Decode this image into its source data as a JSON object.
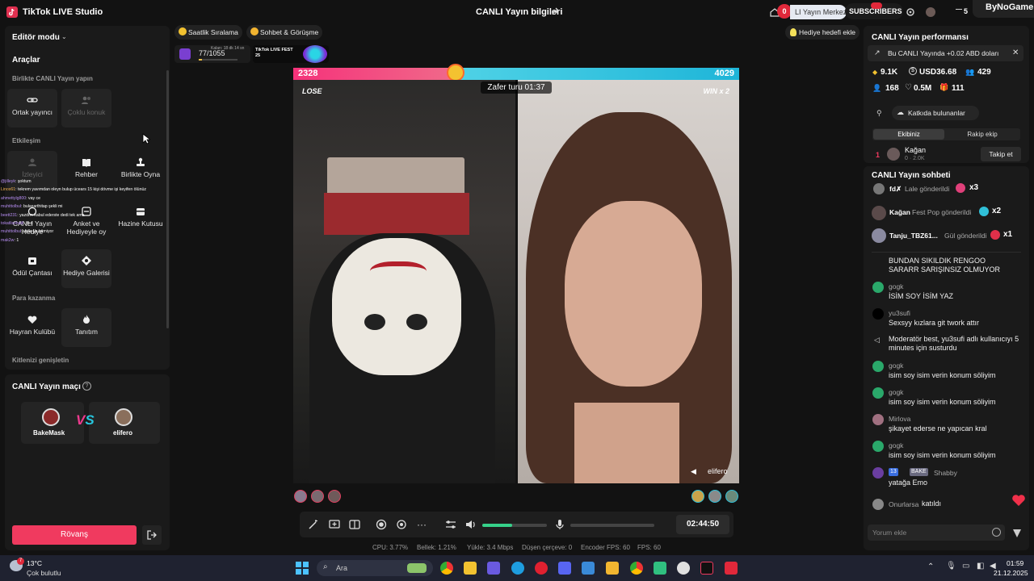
{
  "titlebar": {
    "app_name": "TikTok LIVE Studio",
    "center_title": "CANLI Yayın bilgileri",
    "live_center": "LI Yayın Merkez",
    "notif_count": "0",
    "subscribers_label": "SUBSCRIBERS",
    "count_badge": "5",
    "brand": "ByNoGame"
  },
  "sidebar": {
    "editor_mode": "Editör modu",
    "tools_title": "Araçlar",
    "sections": {
      "together": "Birlikte CANLI Yayın yapın",
      "interaction": "Etkileşim",
      "monetization": "Para kazanma",
      "expand_audience": "Kitlenizi genişletin"
    },
    "tools": {
      "cohost": "Ortak yayıncı",
      "multi_guest": "Çoklu konuk",
      "viewer": "İzleyici",
      "guide": "Rehber",
      "play_together": "Birlikte Oyna",
      "live_gift": "CANLI Yayın Hediye",
      "gift_vote": "Anket ve Hediyeyle oy",
      "treasure": "Hazine Kutusu",
      "reward_bag": "Ödül Çantası",
      "gift_gallery": "Hediye Galerisi",
      "fan_club": "Hayran Kulübü",
      "promotion": "Tanıtım"
    }
  },
  "overlay_chat": [
    {
      "user": "@jilleyk",
      "text": ": şoktum"
    },
    {
      "user": "Linos61",
      "text": ": tekrem yavımdan oleyn bulup ücears 15 kişi dövme işi keyifen ölünüz"
    },
    {
      "user": "ahmettylg800",
      "text": ": vay ce"
    },
    {
      "user": "muhittolbul",
      "text": ": bulasarthitap şekli mi"
    },
    {
      "user": "beett231",
      "text": ": yazdım kabul ederste dedi tek ama"
    },
    {
      "user": "tokatlisokatli",
      "text": ": dsd"
    },
    {
      "user": "muhittolbul",
      "text": ": yalla ya bitmiyor"
    },
    {
      "user": "mak2w",
      "text": ": 1"
    }
  ],
  "match": {
    "title": "CANLI Yayın maçı",
    "player1": "BakeMask",
    "player2": "elifero",
    "rematch": "Rövanş"
  },
  "topbar": {
    "hourly_ranking": "Saatlik Sıralama",
    "chat_meet": "Sohbet & Görüşme",
    "add_gift_goal": "Hediye hedefi ekle",
    "goal_progress": "77/1055",
    "goal_time": "Kalan: 18 dk 14 sn",
    "fest_title": "TikTok LIVE FEST 25"
  },
  "battle": {
    "left_score": "2328",
    "right_score": "4029",
    "left_fraction": 0.364,
    "round_label": "Zafer turu 01:37",
    "left_result": "LOSE",
    "right_result": "WIN x 2",
    "right_streamer": "elifero"
  },
  "controls": {
    "timer": "02:44:50",
    "volume": 0.75
  },
  "stats": {
    "cpu": "CPU: 3.77%",
    "memory": "Bellek: 1.21%",
    "upload": "Yükle: 3.4 Mbps",
    "dropped": "Düşen çerçeve: 0",
    "encoder_fps": "Encoder FPS: 60",
    "fps": "FPS: 60"
  },
  "performance": {
    "title": "CANLI Yayın performansı",
    "banner": "Bu CANLI Yayında +0.02 ABD doları",
    "diamonds": "9.1K",
    "usd": "USD36.68",
    "viewers": "429",
    "new_followers": "168",
    "likes": "0.5M",
    "gifters": "111",
    "contributors_btn": "Katkıda bulunanlar",
    "tab_ours": "Ekibiniz",
    "tab_opponent": "Rakip ekip",
    "top_rank": "1",
    "top_user": "Kağan",
    "top_sub": "0 · 2.0K",
    "follow_btn": "Takip et"
  },
  "chat": {
    "title": "CANLI Yayın sohbeti",
    "gifts": [
      {
        "user": "fd✗",
        "action": "Lale gönderildi",
        "count": "x3"
      },
      {
        "user": "Kağan",
        "action": "Fest Pop gönderildi",
        "count": "x2"
      },
      {
        "user": "Tanju_TBZ61...",
        "action": "Gül gönderildi",
        "count": "x1"
      }
    ],
    "top_msg": "BUNDAN SIKILDIK RENGOO SARARR SARIŞINSIZ OLMUYOR",
    "messages": [
      {
        "user": "gogk",
        "text": "İSİM SOY İSİM YAZ"
      },
      {
        "user": "yu3sufi",
        "text": "Sexsyy kızlara git twork attır"
      },
      {
        "user": "gogk",
        "text": "isim soy isim verin konum söliyim"
      },
      {
        "user": "gogk",
        "text": "isim soy isim verin konum söliyim"
      },
      {
        "user": "Mirlova",
        "text": "şikayet ederse ne yapıcan kral"
      },
      {
        "user": "gogk",
        "text": "isim soy isim verin konum söliyim"
      },
      {
        "user": "Shabby",
        "text": "yatağa Emo"
      }
    ],
    "mod_notice": "Moderatör best, yu3sufi adlı kullanıcıyı 5 minutes için susturdu",
    "badge_level": "13",
    "badge_team": "BAKE",
    "joined_user": "Onurlarsa",
    "joined_text": "katıldı",
    "input_placeholder": "Yorum ekle"
  },
  "taskbar": {
    "temp": "13°C",
    "weather": "Çok bulutlu",
    "weather_badge": "7",
    "search": "Ara",
    "time": "01:59",
    "date": "21.12.2025"
  },
  "colors": {
    "accent": "#f03a5f",
    "cyan": "#25c4dc",
    "bg": "#121212",
    "panel": "#1a1a1a"
  }
}
